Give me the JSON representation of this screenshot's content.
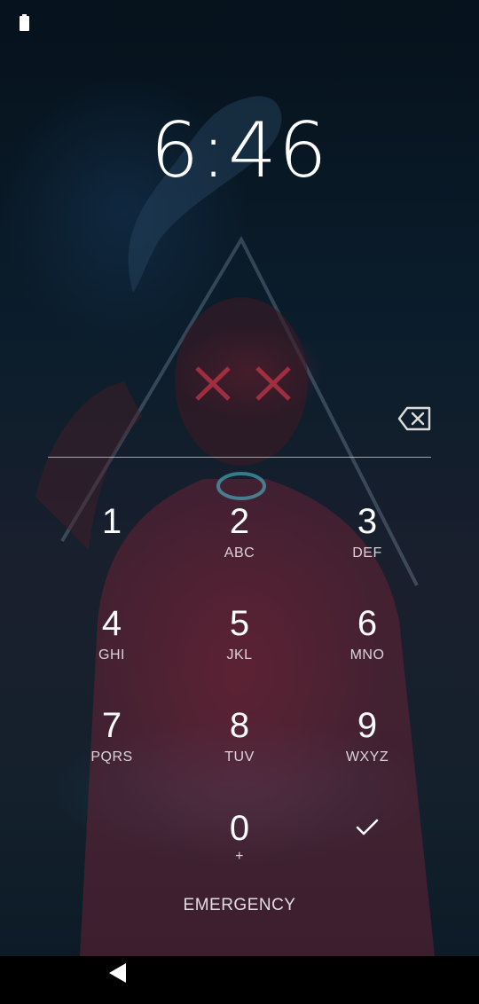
{
  "status_bar": {
    "battery_icon": "battery-icon"
  },
  "clock": {
    "time": "6:46"
  },
  "pin_entry": {
    "backspace_icon": "backspace-icon"
  },
  "keypad": {
    "keys": [
      {
        "digit": "1",
        "letters": ""
      },
      {
        "digit": "2",
        "letters": "ABC"
      },
      {
        "digit": "3",
        "letters": "DEF"
      },
      {
        "digit": "4",
        "letters": "GHI"
      },
      {
        "digit": "5",
        "letters": "JKL"
      },
      {
        "digit": "6",
        "letters": "MNO"
      },
      {
        "digit": "7",
        "letters": "PQRS"
      },
      {
        "digit": "8",
        "letters": "TUV"
      },
      {
        "digit": "9",
        "letters": "WXYZ"
      },
      {
        "digit": "0",
        "letters": "+"
      }
    ],
    "enter_icon": "checkmark-icon"
  },
  "emergency": {
    "label": "EMERGENCY"
  },
  "nav_bar": {
    "back_icon": "back-triangle-icon"
  },
  "colors": {
    "text": "#ffffff",
    "nav_bar": "#000000",
    "accent_red": "#8c283c",
    "accent_blue": "#28607a"
  }
}
